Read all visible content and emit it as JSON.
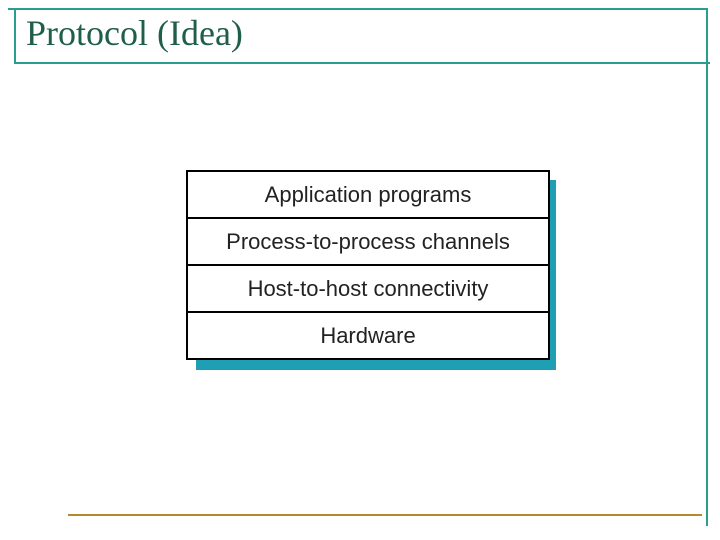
{
  "title": "Protocol (Idea)",
  "layers": {
    "l0": "Application programs",
    "l1": "Process-to-process channels",
    "l2": "Host-to-host connectivity",
    "l3": "Hardware"
  }
}
